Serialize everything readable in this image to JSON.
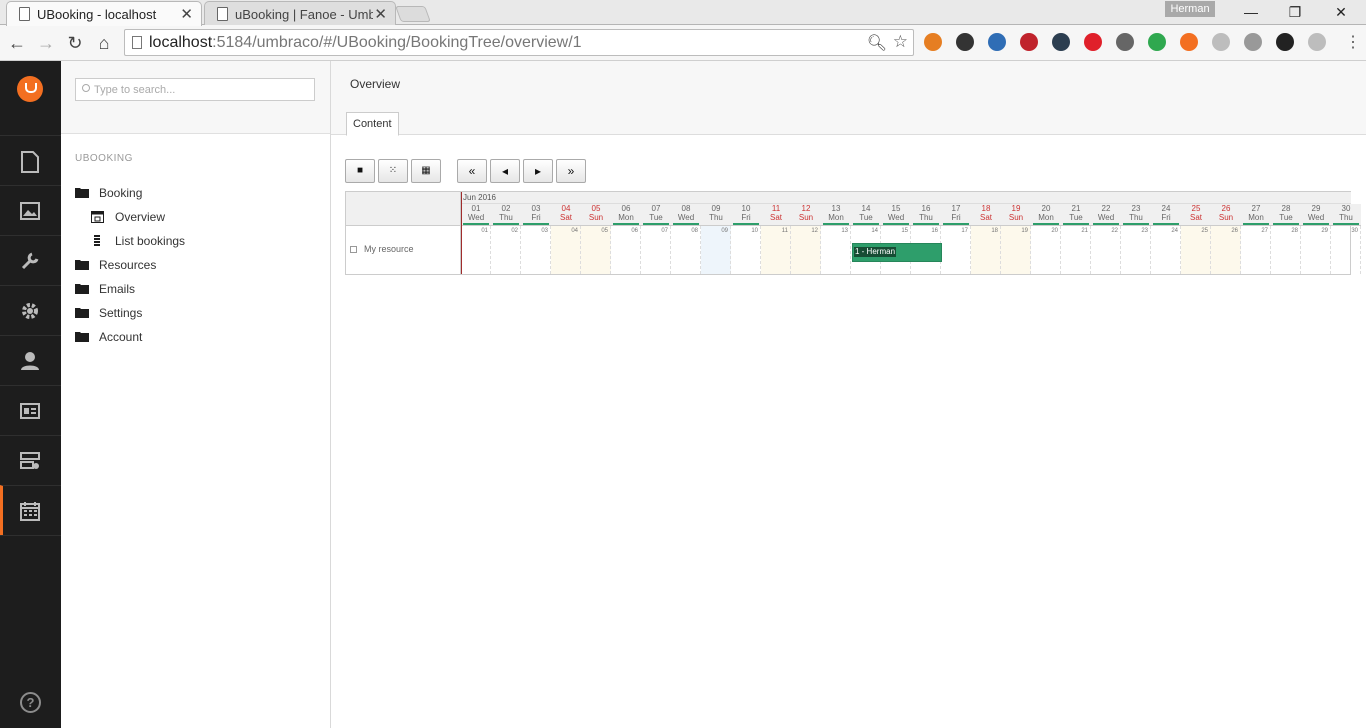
{
  "browser": {
    "tabs": [
      {
        "title": "UBooking - localhost",
        "close": "✕"
      },
      {
        "title": "uBooking | Fanoe - Umbraco",
        "close": "✕"
      }
    ],
    "profile": "Herman",
    "window": {
      "minimize": "—",
      "restore": "❐",
      "close": "✕"
    },
    "nav": {
      "back": "←",
      "forward": "→",
      "reload": "↻",
      "home": "⌂"
    },
    "url_host": "localhost",
    "url_rest": ":5184/umbraco/#/UBooking/BookingTree/overview/1",
    "menu": "⋮",
    "extensions": [
      {
        "name": "pencil-extension-icon",
        "color": "#e67e22"
      },
      {
        "name": "colorzilla-extension-icon",
        "color": "#333333"
      },
      {
        "name": "folder-extension-icon",
        "color": "#2f6db5"
      },
      {
        "name": "red-square-extension-icon",
        "color": "#c0232c"
      },
      {
        "name": "branch-extension-icon",
        "color": "#2c3e50"
      },
      {
        "name": "opera-extension-icon",
        "color": "#e0202a"
      },
      {
        "name": "cast-extension-icon",
        "color": "#666666"
      },
      {
        "name": "leaf-extension-icon",
        "color": "#2fa84f"
      },
      {
        "name": "umbraco-extension-icon",
        "color": "#f36f21"
      },
      {
        "name": "skype-extension-icon",
        "color": "#bdbdbd"
      },
      {
        "name": "info-extension-icon",
        "color": "#999999"
      },
      {
        "name": "dark-circle-extension-icon",
        "color": "#222222"
      },
      {
        "name": "m-extension-icon",
        "color": "#bdbdbd"
      }
    ]
  },
  "tree": {
    "search_placeholder": "Type to search...",
    "title": "UBOOKING",
    "nodes": [
      {
        "label": "Booking",
        "icon": "folder-icon"
      },
      {
        "label": "Overview",
        "icon": "calendar-icon"
      },
      {
        "label": "List bookings",
        "icon": "list-icon"
      },
      {
        "label": "Resources",
        "icon": "folder-icon"
      },
      {
        "label": "Emails",
        "icon": "folder-icon"
      },
      {
        "label": "Settings",
        "icon": "folder-icon"
      },
      {
        "label": "Account",
        "icon": "folder-icon"
      }
    ]
  },
  "content": {
    "title": "Overview",
    "tab": "Content",
    "view_buttons": [
      "■",
      "⁙",
      "▦"
    ],
    "nav_buttons": [
      "«",
      "◂",
      "▸",
      "»"
    ]
  },
  "scheduler": {
    "month": "Jun 2016",
    "resource": "My resource",
    "today_index": 8,
    "days": [
      {
        "d": "01",
        "w": "Wed"
      },
      {
        "d": "02",
        "w": "Thu"
      },
      {
        "d": "03",
        "w": "Fri"
      },
      {
        "d": "04",
        "w": "Sat"
      },
      {
        "d": "05",
        "w": "Sun"
      },
      {
        "d": "06",
        "w": "Mon"
      },
      {
        "d": "07",
        "w": "Tue"
      },
      {
        "d": "08",
        "w": "Wed"
      },
      {
        "d": "09",
        "w": "Thu"
      },
      {
        "d": "10",
        "w": "Fri"
      },
      {
        "d": "11",
        "w": "Sat"
      },
      {
        "d": "12",
        "w": "Sun"
      },
      {
        "d": "13",
        "w": "Mon"
      },
      {
        "d": "14",
        "w": "Tue"
      },
      {
        "d": "15",
        "w": "Wed"
      },
      {
        "d": "16",
        "w": "Thu"
      },
      {
        "d": "17",
        "w": "Fri"
      },
      {
        "d": "18",
        "w": "Sat"
      },
      {
        "d": "19",
        "w": "Sun"
      },
      {
        "d": "20",
        "w": "Mon"
      },
      {
        "d": "21",
        "w": "Tue"
      },
      {
        "d": "22",
        "w": "Wed"
      },
      {
        "d": "23",
        "w": "Thu"
      },
      {
        "d": "24",
        "w": "Fri"
      },
      {
        "d": "25",
        "w": "Sat"
      },
      {
        "d": "26",
        "w": "Sun"
      },
      {
        "d": "27",
        "w": "Mon"
      },
      {
        "d": "28",
        "w": "Tue"
      },
      {
        "d": "29",
        "w": "Wed"
      },
      {
        "d": "30",
        "w": "Thu"
      }
    ],
    "booking": {
      "label": "1 - Herman",
      "start": "14",
      "end": "16",
      "color": "#2e9e6b"
    }
  }
}
